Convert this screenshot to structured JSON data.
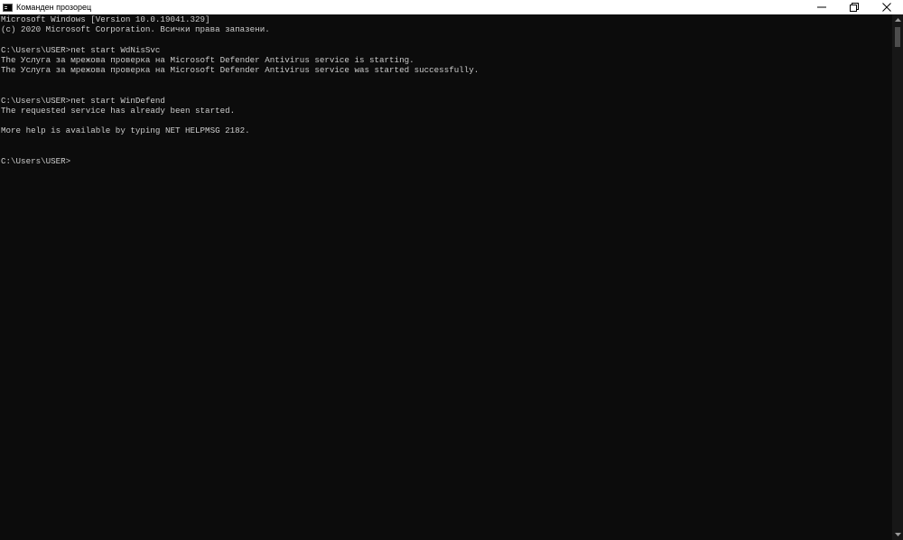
{
  "window": {
    "title": "Команден прозорец"
  },
  "console": {
    "lines": [
      "Microsoft Windows [Version 10.0.19041.329]",
      "(c) 2020 Microsoft Corporation. Всички права запазени.",
      "",
      "C:\\Users\\USER>net start WdNisSvc",
      "The Услуга за мрежова проверка на Microsoft Defender Antivirus service is starting.",
      "The Услуга за мрежова проверка на Microsoft Defender Antivirus service was started successfully.",
      "",
      "",
      "C:\\Users\\USER>net start WinDefend",
      "The requested service has already been started.",
      "",
      "More help is available by typing NET HELPMSG 2182.",
      "",
      "",
      "C:\\Users\\USER>"
    ]
  },
  "icons": {
    "app": "cmd-icon",
    "minimize": "minimize-icon",
    "restore": "restore-icon",
    "close": "close-icon"
  },
  "colors": {
    "background": "#0c0c0c",
    "text": "#cccccc",
    "titlebar": "#ffffff"
  }
}
